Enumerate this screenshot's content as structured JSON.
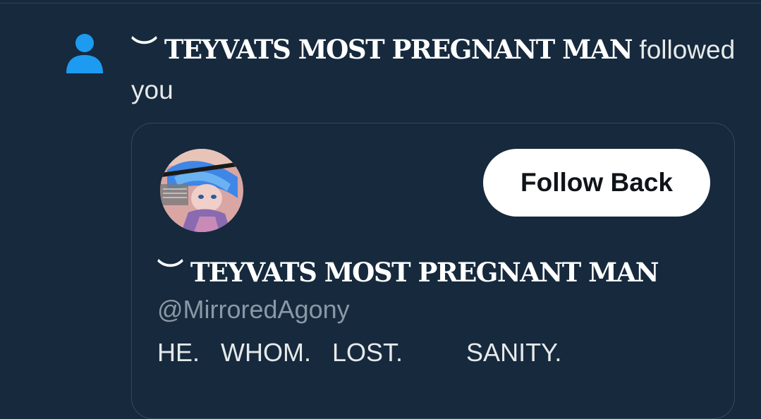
{
  "notification": {
    "icon": "person-icon",
    "accent_color": "#1d9bf0",
    "name_prefix": "︶",
    "name": "TEYVATS MOST PREGNANT MAN",
    "action_text": " followed you"
  },
  "card": {
    "avatar_icon": "avatar",
    "follow_button_label": "Follow Back",
    "name_prefix": "︶",
    "name": "TEYVATS MOST PREGNANT MAN",
    "handle": "@MirroredAgony",
    "bio": "HE.   WHOM.   LOST.         SANITY."
  }
}
